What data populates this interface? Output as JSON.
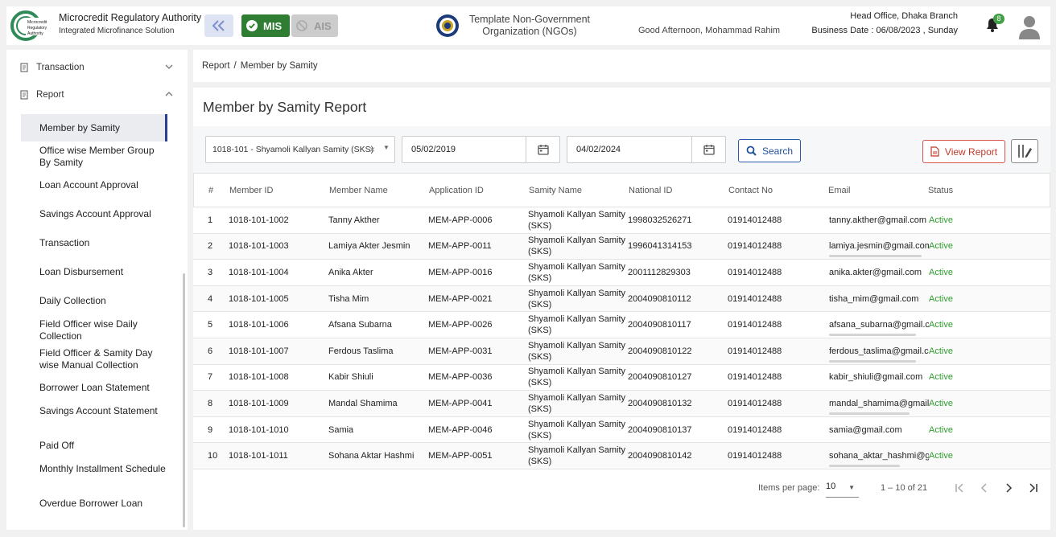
{
  "header": {
    "app_title": "Microcredit Regulatory Authority",
    "app_subtitle": "Integrated Microfinance Solution",
    "logo_text": "Microcredit Regulatory Authority",
    "mis_label": "MIS",
    "ais_label": "AIS",
    "org_line1": "Template Non-Government",
    "org_line2": "Organization (NGOs)",
    "greeting": "Good Afternoon, Mohammad Rahim",
    "branch": "Head Office, Dhaka Branch",
    "business_date": "Business Date : 06/08/2023 , Sunday",
    "notification_count": "8",
    "accent": "#2e7d32"
  },
  "sidebar": {
    "groups": [
      {
        "label": "Transaction",
        "icon": "document-icon",
        "state": "collapsed"
      },
      {
        "label": "Report",
        "icon": "document-icon",
        "state": "expanded"
      }
    ],
    "items": [
      {
        "label": "Member by Samity",
        "active": true
      },
      {
        "label": "Office wise Member Group By Samity"
      },
      {
        "label": "Loan Account Approval"
      },
      {
        "label": "Savings Account Approval"
      },
      {
        "label": "Transaction"
      },
      {
        "label": "Loan Disbursement"
      },
      {
        "label": "Daily Collection"
      },
      {
        "label": "Field Officer wise Daily Collection"
      },
      {
        "label": "Field Officer & Samity Day wise Manual Collection"
      },
      {
        "label": "Borrower Loan Statement"
      },
      {
        "label": "Savings Account Statement"
      },
      {
        "label": "Paid Off"
      },
      {
        "label": "Monthly Installment Schedule"
      },
      {
        "label": "Overdue Borrower Loan"
      }
    ]
  },
  "breadcrumb": {
    "root": "Report",
    "sep": "/",
    "current": "Member by Samity"
  },
  "page": {
    "title": "Member by Samity Report"
  },
  "filters": {
    "samity": "1018-101 - Shyamoli Kallyan Samity (SKS)",
    "from_date": "05/02/2019",
    "to_date": "04/02/2024",
    "search_label": "Search",
    "view_report_label": "View Report"
  },
  "table": {
    "headers": [
      "#",
      "Member ID",
      "Member Name",
      "Application ID",
      "Samity Name",
      "National ID",
      "Contact No",
      "Email",
      "Status"
    ],
    "rows": [
      {
        "n": "1",
        "id": "1018-101-1002",
        "name": "Tanny Akther",
        "app": "MEM-APP-0006",
        "samity": "Shyamoli Kallyan Samity (SKS)",
        "nid": "1998032526271",
        "contact": "01914012488",
        "email": "tanny.akther@gmail.com",
        "status": "Active"
      },
      {
        "n": "2",
        "id": "1018-101-1003",
        "name": "Lamiya Akter Jesmin",
        "app": "MEM-APP-0011",
        "samity": "Shyamoli Kallyan Samity (SKS)",
        "nid": "1996041314153",
        "contact": "01914012488",
        "email": "lamiya.jesmin@gmail.com",
        "status": "Active"
      },
      {
        "n": "3",
        "id": "1018-101-1004",
        "name": "Anika Akter",
        "app": "MEM-APP-0016",
        "samity": "Shyamoli Kallyan Samity (SKS)",
        "nid": "2001112829303",
        "contact": "01914012488",
        "email": "anika.akter@gmail.com",
        "status": "Active"
      },
      {
        "n": "4",
        "id": "1018-101-1005",
        "name": "Tisha Mim",
        "app": "MEM-APP-0021",
        "samity": "Shyamoli Kallyan Samity (SKS)",
        "nid": "2004090810112",
        "contact": "01914012488",
        "email": "tisha_mim@gmail.com",
        "status": "Active"
      },
      {
        "n": "5",
        "id": "1018-101-1006",
        "name": "Afsana Subarna",
        "app": "MEM-APP-0026",
        "samity": "Shyamoli Kallyan Samity (SKS)",
        "nid": "2004090810117",
        "contact": "01914012488",
        "email": "afsana_subarna@gmail.com",
        "status": "Active"
      },
      {
        "n": "6",
        "id": "1018-101-1007",
        "name": "Ferdous Taslima",
        "app": "MEM-APP-0031",
        "samity": "Shyamoli Kallyan Samity (SKS)",
        "nid": "2004090810122",
        "contact": "01914012488",
        "email": "ferdous_taslima@gmail.com",
        "status": "Active"
      },
      {
        "n": "7",
        "id": "1018-101-1008",
        "name": "Kabir Shiuli",
        "app": "MEM-APP-0036",
        "samity": "Shyamoli Kallyan Samity (SKS)",
        "nid": "2004090810127",
        "contact": "01914012488",
        "email": "kabir_shiuli@gmail.com",
        "status": "Active"
      },
      {
        "n": "8",
        "id": "1018-101-1009",
        "name": "Mandal Shamima",
        "app": "MEM-APP-0041",
        "samity": "Shyamoli Kallyan Samity (SKS)",
        "nid": "2004090810132",
        "contact": "01914012488",
        "email": "mandal_shamima@gmail.com",
        "status": "Active"
      },
      {
        "n": "9",
        "id": "1018-101-1010",
        "name": "Samia",
        "app": "MEM-APP-0046",
        "samity": "Shyamoli Kallyan Samity (SKS)",
        "nid": "2004090810137",
        "contact": "01914012488",
        "email": "samia@gmail.com",
        "status": "Active"
      },
      {
        "n": "10",
        "id": "1018-101-1011",
        "name": "Sohana Aktar Hashmi",
        "app": "MEM-APP-0051",
        "samity": "Shyamoli Kallyan Samity (SKS)",
        "nid": "2004090810142",
        "contact": "01914012488",
        "email": "sohana_aktar_hashmi@gmail.com",
        "status": "Active"
      }
    ]
  },
  "pagination": {
    "items_per_page_label": "Items per page:",
    "items_per_page": "10",
    "range": "1 – 10 of 21"
  }
}
